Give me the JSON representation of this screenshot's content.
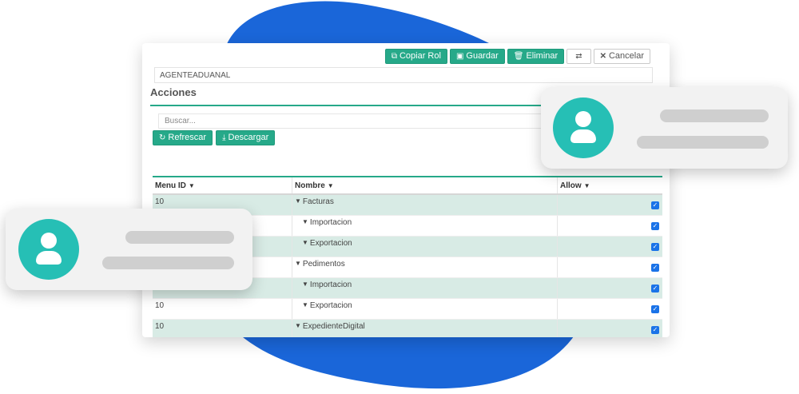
{
  "toolbar": {
    "copy_label": "Copiar Rol",
    "save_label": "Guardar",
    "delete_label": "Eliminar",
    "swap_icon": "swap-arrows-icon",
    "cancel_label": "Cancelar"
  },
  "role_name": "AGENTEADUANAL",
  "section_title": "Acciones",
  "search": {
    "placeholder": "Buscar..."
  },
  "actions": {
    "refresh_label": "Refrescar",
    "download_label": "Descargar"
  },
  "table": {
    "headers": [
      "Menu ID",
      "Nombre",
      "Allow"
    ],
    "rows": [
      {
        "menu_id": "10",
        "nombre": "Facturas",
        "allow": true
      },
      {
        "menu_id": "",
        "nombre": "Importacion",
        "allow": true
      },
      {
        "menu_id": "",
        "nombre": "Exportacion",
        "allow": true
      },
      {
        "menu_id": "",
        "nombre": "Pedimentos",
        "allow": true
      },
      {
        "menu_id": "",
        "nombre": "Importacion",
        "allow": true
      },
      {
        "menu_id": "10",
        "nombre": "Exportacion",
        "allow": true
      },
      {
        "menu_id": "10",
        "nombre": "ExpedienteDigital",
        "allow": true
      }
    ]
  },
  "colors": {
    "accent": "#26a989",
    "blob": "#1a66d9",
    "avatar": "#26bfb5",
    "checkbox": "#1a73e8"
  }
}
